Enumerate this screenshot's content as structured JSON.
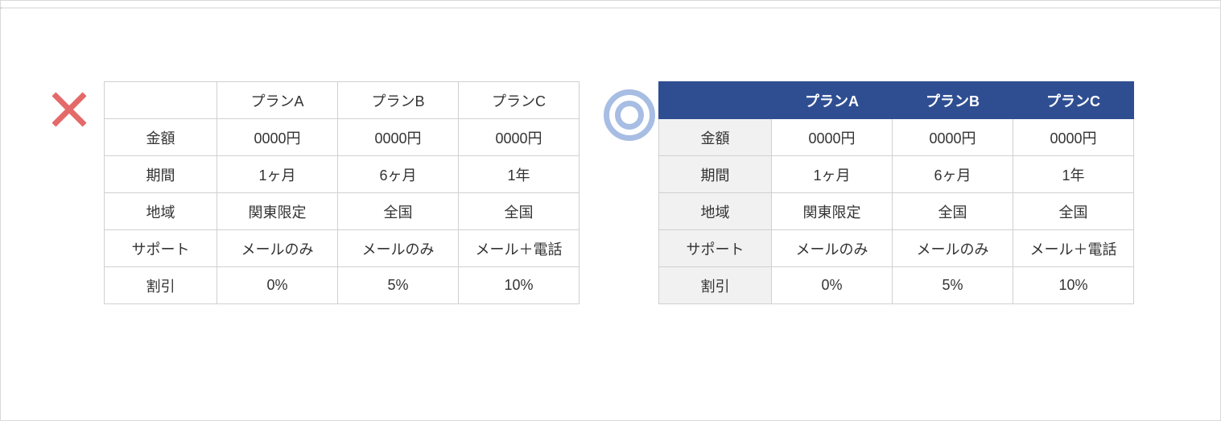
{
  "chart_data": [
    {
      "type": "table",
      "name": "bad-example",
      "headers": [
        "",
        "プランA",
        "プランB",
        "プランC"
      ],
      "rows": [
        {
          "label": "金額",
          "values": [
            "0000円",
            "0000円",
            "0000円"
          ]
        },
        {
          "label": "期間",
          "values": [
            "1ヶ月",
            "6ヶ月",
            "1年"
          ]
        },
        {
          "label": "地域",
          "values": [
            "関東限定",
            "全国",
            "全国"
          ]
        },
        {
          "label": "サポート",
          "values": [
            "メールのみ",
            "メールのみ",
            "メール＋電話"
          ]
        },
        {
          "label": "割引",
          "values": [
            "0%",
            "5%",
            "10%"
          ]
        }
      ]
    },
    {
      "type": "table",
      "name": "good-example",
      "headers": [
        "",
        "プランA",
        "プランB",
        "プランC"
      ],
      "rows": [
        {
          "label": "金額",
          "values": [
            "0000円",
            "0000円",
            "0000円"
          ]
        },
        {
          "label": "期間",
          "values": [
            "1ヶ月",
            "6ヶ月",
            "1年"
          ]
        },
        {
          "label": "地域",
          "values": [
            "関東限定",
            "全国",
            "全国"
          ]
        },
        {
          "label": "サポート",
          "values": [
            "メールのみ",
            "メールのみ",
            "メール＋電話"
          ]
        },
        {
          "label": "割引",
          "values": [
            "0%",
            "5%",
            "10%"
          ]
        }
      ]
    }
  ]
}
